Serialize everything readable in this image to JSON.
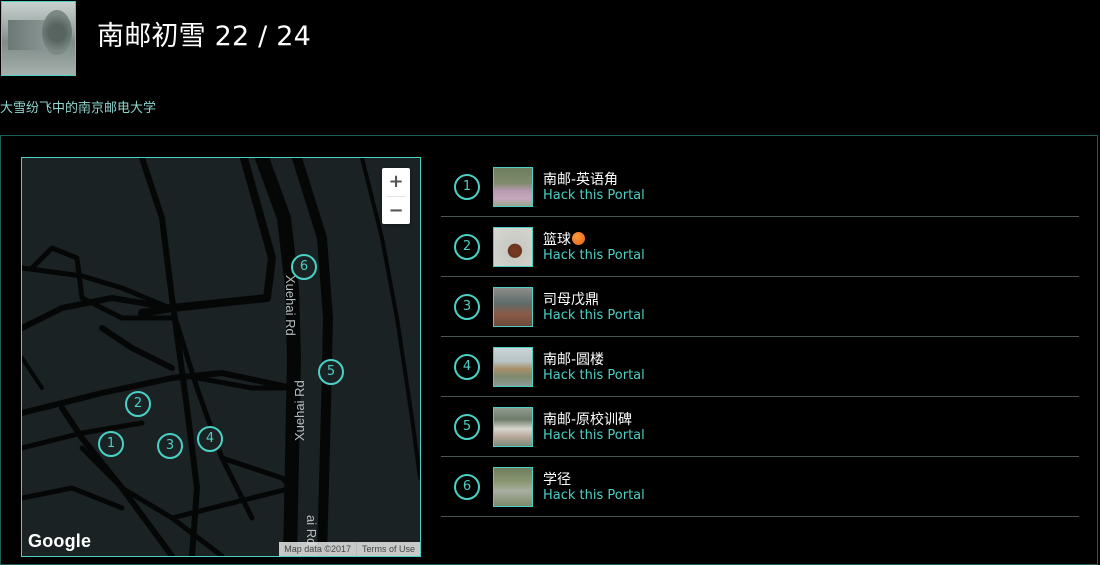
{
  "mission": {
    "title": "南邮初雪 22 / 24",
    "description": "大雪纷飞中的南京邮电大学"
  },
  "map": {
    "zoom_in": "+",
    "zoom_out": "−",
    "logo": "Google",
    "map_data": "Map data ©2017",
    "terms": "Terms of Use",
    "road_labels": [
      "Xuehai Rd",
      "Xuehai Rd",
      "ai Rd"
    ],
    "markers": [
      "1",
      "2",
      "3",
      "4",
      "5",
      "6"
    ]
  },
  "portals": [
    {
      "number": "1",
      "name": "南邮-英语角",
      "action": "Hack this Portal"
    },
    {
      "number": "2",
      "name": "篮球",
      "action": "Hack this Portal",
      "icon": "basketball-icon"
    },
    {
      "number": "3",
      "name": "司母戊鼎",
      "action": "Hack this Portal"
    },
    {
      "number": "4",
      "name": "南邮-圆楼",
      "action": "Hack this Portal"
    },
    {
      "number": "5",
      "name": "南邮-原校训碑",
      "action": "Hack this Portal"
    },
    {
      "number": "6",
      "name": "学径",
      "action": "Hack this Portal"
    }
  ],
  "colors": {
    "accent": "#4bd0c5",
    "background": "#000000",
    "map_background": "#1b2224"
  }
}
